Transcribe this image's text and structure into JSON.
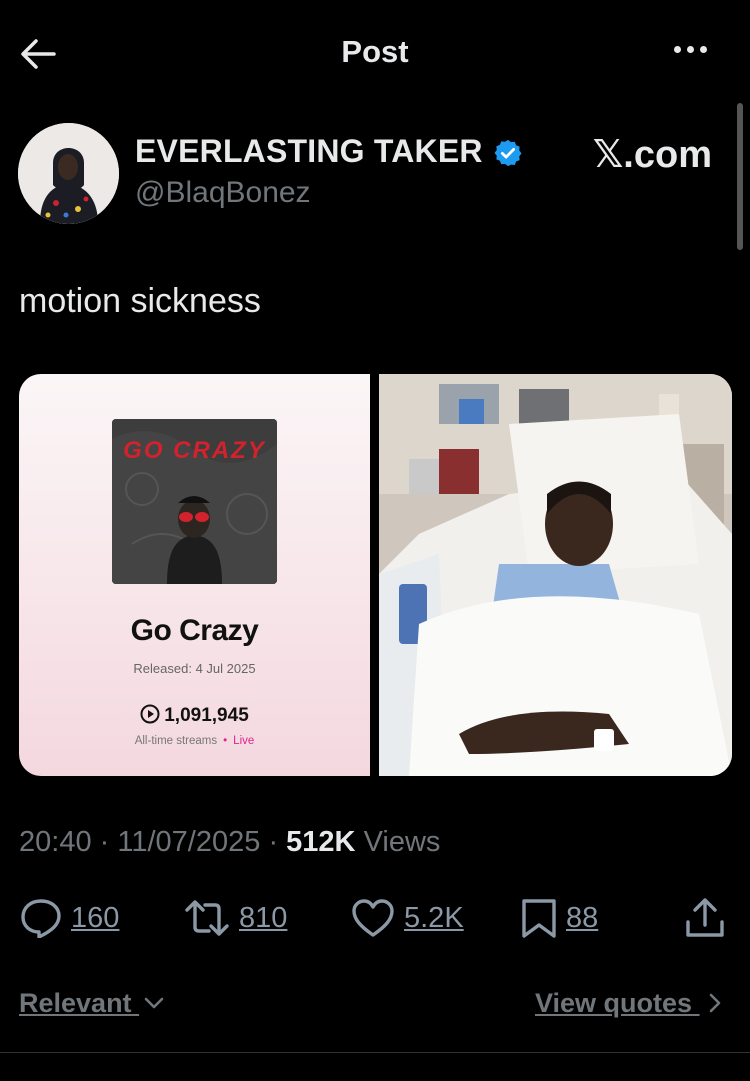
{
  "header": {
    "title": "Post",
    "back_icon": "back-arrow-icon",
    "more_icon": "more-options-icon"
  },
  "author": {
    "name": "EVERLASTING TAKER",
    "handle": "@BlaqBonez",
    "verified": true,
    "verified_color": "#1d9bf0"
  },
  "watermark": "𝕏.com",
  "tweet": {
    "text": "motion sickness"
  },
  "media": {
    "left": {
      "cover_text": "GO CRAZY",
      "title": "Go Crazy",
      "released": "Released: 4 Jul 2025",
      "streams": "1,091,945",
      "sub_label": "All-time streams",
      "sub_dot": "•",
      "live": "Live"
    },
    "right": {
      "description_icon": "photo-hospital-icon"
    }
  },
  "meta": {
    "time": "20:40",
    "sep1": "·",
    "date": "11/07/2025",
    "sep2": "·",
    "views": "512K",
    "views_label": "Views"
  },
  "actions": {
    "replies": "160",
    "reposts": "810",
    "likes": "5.2K",
    "bookmarks": "88"
  },
  "footer": {
    "relevant": "Relevant",
    "view_quotes": "View quotes"
  }
}
